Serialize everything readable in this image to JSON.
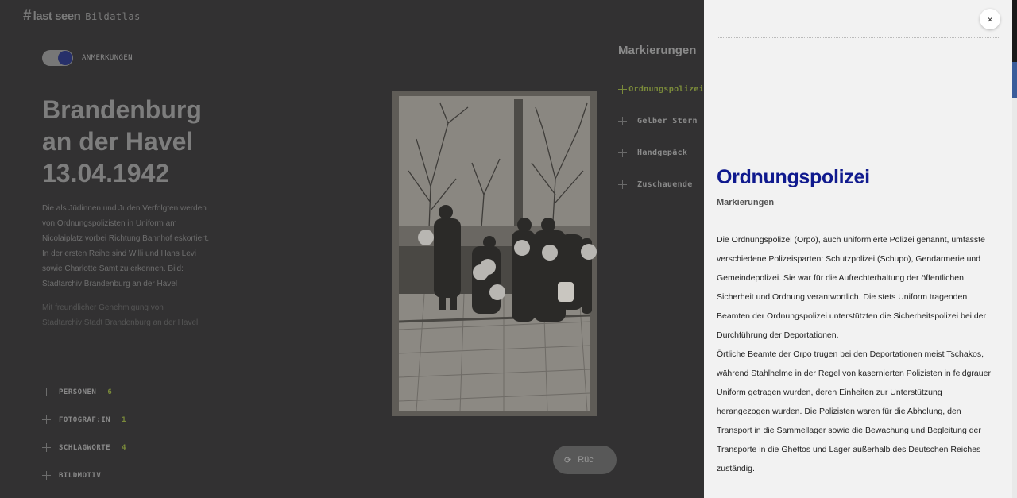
{
  "header": {
    "logo_hash": "#",
    "logo_text": "last seen",
    "logo_sub": "Bildatlas"
  },
  "toggle": {
    "label": "ANMERKUNGEN",
    "on": true
  },
  "title": {
    "line1": "Brandenburg",
    "line2": "an der Havel",
    "line3": "13.04.1942"
  },
  "description": "Die als Jüdinnen und Juden Verfolgten werden von Ordnungspolizisten in Uniform am Nicolaiplatz vorbei Richtung Bahnhof eskortiert. In der ersten Reihe sind Willi und Hans Levi sowie Charlotte Samt zu erkennen. Bild: Stadtarchiv Brandenburg an der Havel",
  "credit": {
    "text": "Mit freundlicher Genehmigung von",
    "link": "Stadtarchiv Stadt Brandenburg an der Havel"
  },
  "accordion": [
    {
      "label": "PERSONEN",
      "count": "6"
    },
    {
      "label": "FOTOGRAF:IN",
      "count": "1"
    },
    {
      "label": "SCHLAGWORTE",
      "count": "4"
    },
    {
      "label": "BILDMOTIV",
      "count": ""
    }
  ],
  "reload_button": {
    "label": "Rüc"
  },
  "markierungen": {
    "title": "Markierungen",
    "items": [
      {
        "label": "Ordnungspolizei",
        "active": true
      },
      {
        "label": "Gelber Stern",
        "active": false
      },
      {
        "label": "Handgepäck",
        "active": false
      },
      {
        "label": "Zuschauende",
        "active": false
      }
    ]
  },
  "panel": {
    "close_label": "×",
    "title": "Ordnungspolizei",
    "subtitle": "Markierungen",
    "paragraph1": "Die Ordnungspolizei (Orpo), auch uniformierte Polizei genannt, umfasste verschiedene Polizeisparten: Schutzpolizei (Schupo), Gendarmerie und Gemeindepolizei. Sie war für die Aufrechterhaltung der öffentlichen Sicherheit und Ordnung verantwortlich. Die stets Uniform tragenden Beamten der Ordnungspolizei unterstützten die Sicherheitspolizei bei der Durchführung der Deportationen.",
    "paragraph2": "Örtliche Beamte der Orpo trugen bei den Deportationen meist Tschakos, während Stahlhelme in der Regel von kasernierten Polizisten in feldgrauer Uniform getragen wurden, deren Einheiten zur Unterstützung herangezogen wurden. Die Polizisten waren für die Abholung, den Transport in die Sammellager sowie die Bewachung und Begleitung der Transporte in die Ghettos und Lager außerhalb des Deutschen Reiches zuständig."
  },
  "colors": {
    "background": "#323132",
    "panel": "#f2f2f2",
    "accent_blue": "#101a8e",
    "accent_green": "#7a8a3a"
  }
}
